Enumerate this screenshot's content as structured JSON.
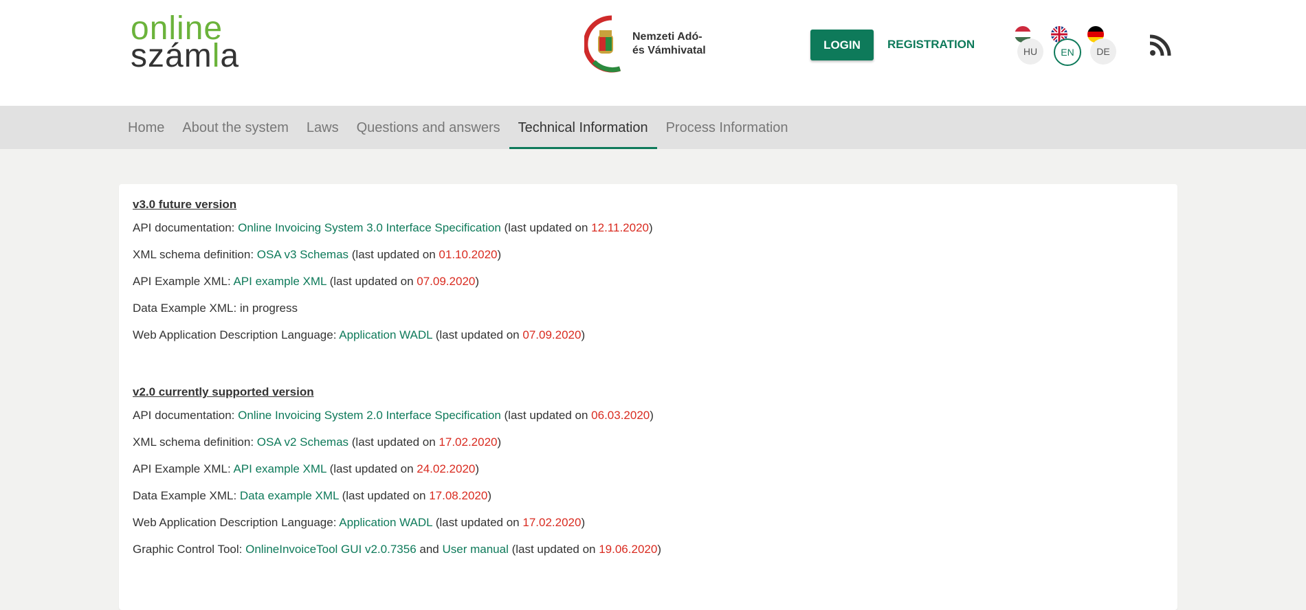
{
  "header": {
    "logo_line1": "online",
    "logo_line2_a": "szám",
    "logo_line2_b": "l",
    "logo_line2_c": "a",
    "agency_line1": "Nemzeti Adó-",
    "agency_line2": "és Vámhivatal",
    "login_label": "LOGIN",
    "registration_label": "REGISTRATION",
    "languages": [
      {
        "code": "HU",
        "flag": "hu-flag-icon",
        "active": false
      },
      {
        "code": "EN",
        "flag": "uk-flag-icon",
        "active": true
      },
      {
        "code": "DE",
        "flag": "de-flag-icon",
        "active": false
      }
    ],
    "rss_icon": "rss-icon"
  },
  "nav": {
    "items": [
      "Home",
      "About the system",
      "Laws",
      "Questions and answers",
      "Technical Information",
      "Process Information"
    ],
    "active_index": 4
  },
  "v3": {
    "title": "v3.0 future version",
    "rows": [
      {
        "label": "API documentation: ",
        "link": "Online Invoicing System 3.0 Interface Specification",
        "pre": " (last updated on ",
        "date": "12.11.2020",
        "post": ")"
      },
      {
        "label": "XML schema definition: ",
        "link": "OSA v3 Schemas",
        "pre": " (last updated on ",
        "date": "01.10.2020",
        "post": ")"
      },
      {
        "label": "API Example XML: ",
        "link": "API example XML",
        "pre": " (last updated on ",
        "date": "07.09.2020",
        "post": ")"
      },
      {
        "label": "Data Example XML: in progress"
      },
      {
        "label": "Web Application Description Language: ",
        "link": "Application WADL",
        "pre": " (last updated on ",
        "date": "07.09.2020",
        "post": ")"
      }
    ]
  },
  "v2": {
    "title": "v2.0 currently supported version",
    "rows": [
      {
        "label": "API documentation: ",
        "link": "Online Invoicing System 2.0 Interface Specification",
        "pre": " (last updated on ",
        "date": "06.03.2020",
        "post": ")"
      },
      {
        "label": "XML schema definition: ",
        "link": "OSA v2 Schemas",
        "pre": " (last updated on ",
        "date": "17.02.2020",
        "post": ")"
      },
      {
        "label": "API Example XML: ",
        "link": "API example XML",
        "pre": " (last updated on ",
        "date": "24.02.2020",
        "post": ")"
      },
      {
        "label": "Data Example XML: ",
        "link": "Data example XML",
        "pre": " (last updated on ",
        "date": "17.08.2020",
        "post": ")"
      },
      {
        "label": "Web Application Description Language: ",
        "link": "Application WADL",
        "pre": " (last updated on ",
        "date": "17.02.2020",
        "post": ")"
      },
      {
        "label": "Graphic Control Tool: ",
        "link": "OnlineInvoiceTool GUI v2.0.7356",
        "mid": " and ",
        "link2": "User manual",
        "pre": " (last updated on ",
        "date": "19.06.2020",
        "post": ")"
      }
    ]
  },
  "colors": {
    "accent": "#0e7a5a",
    "logo_green": "#6bb33b",
    "date_red": "#d92b20"
  }
}
